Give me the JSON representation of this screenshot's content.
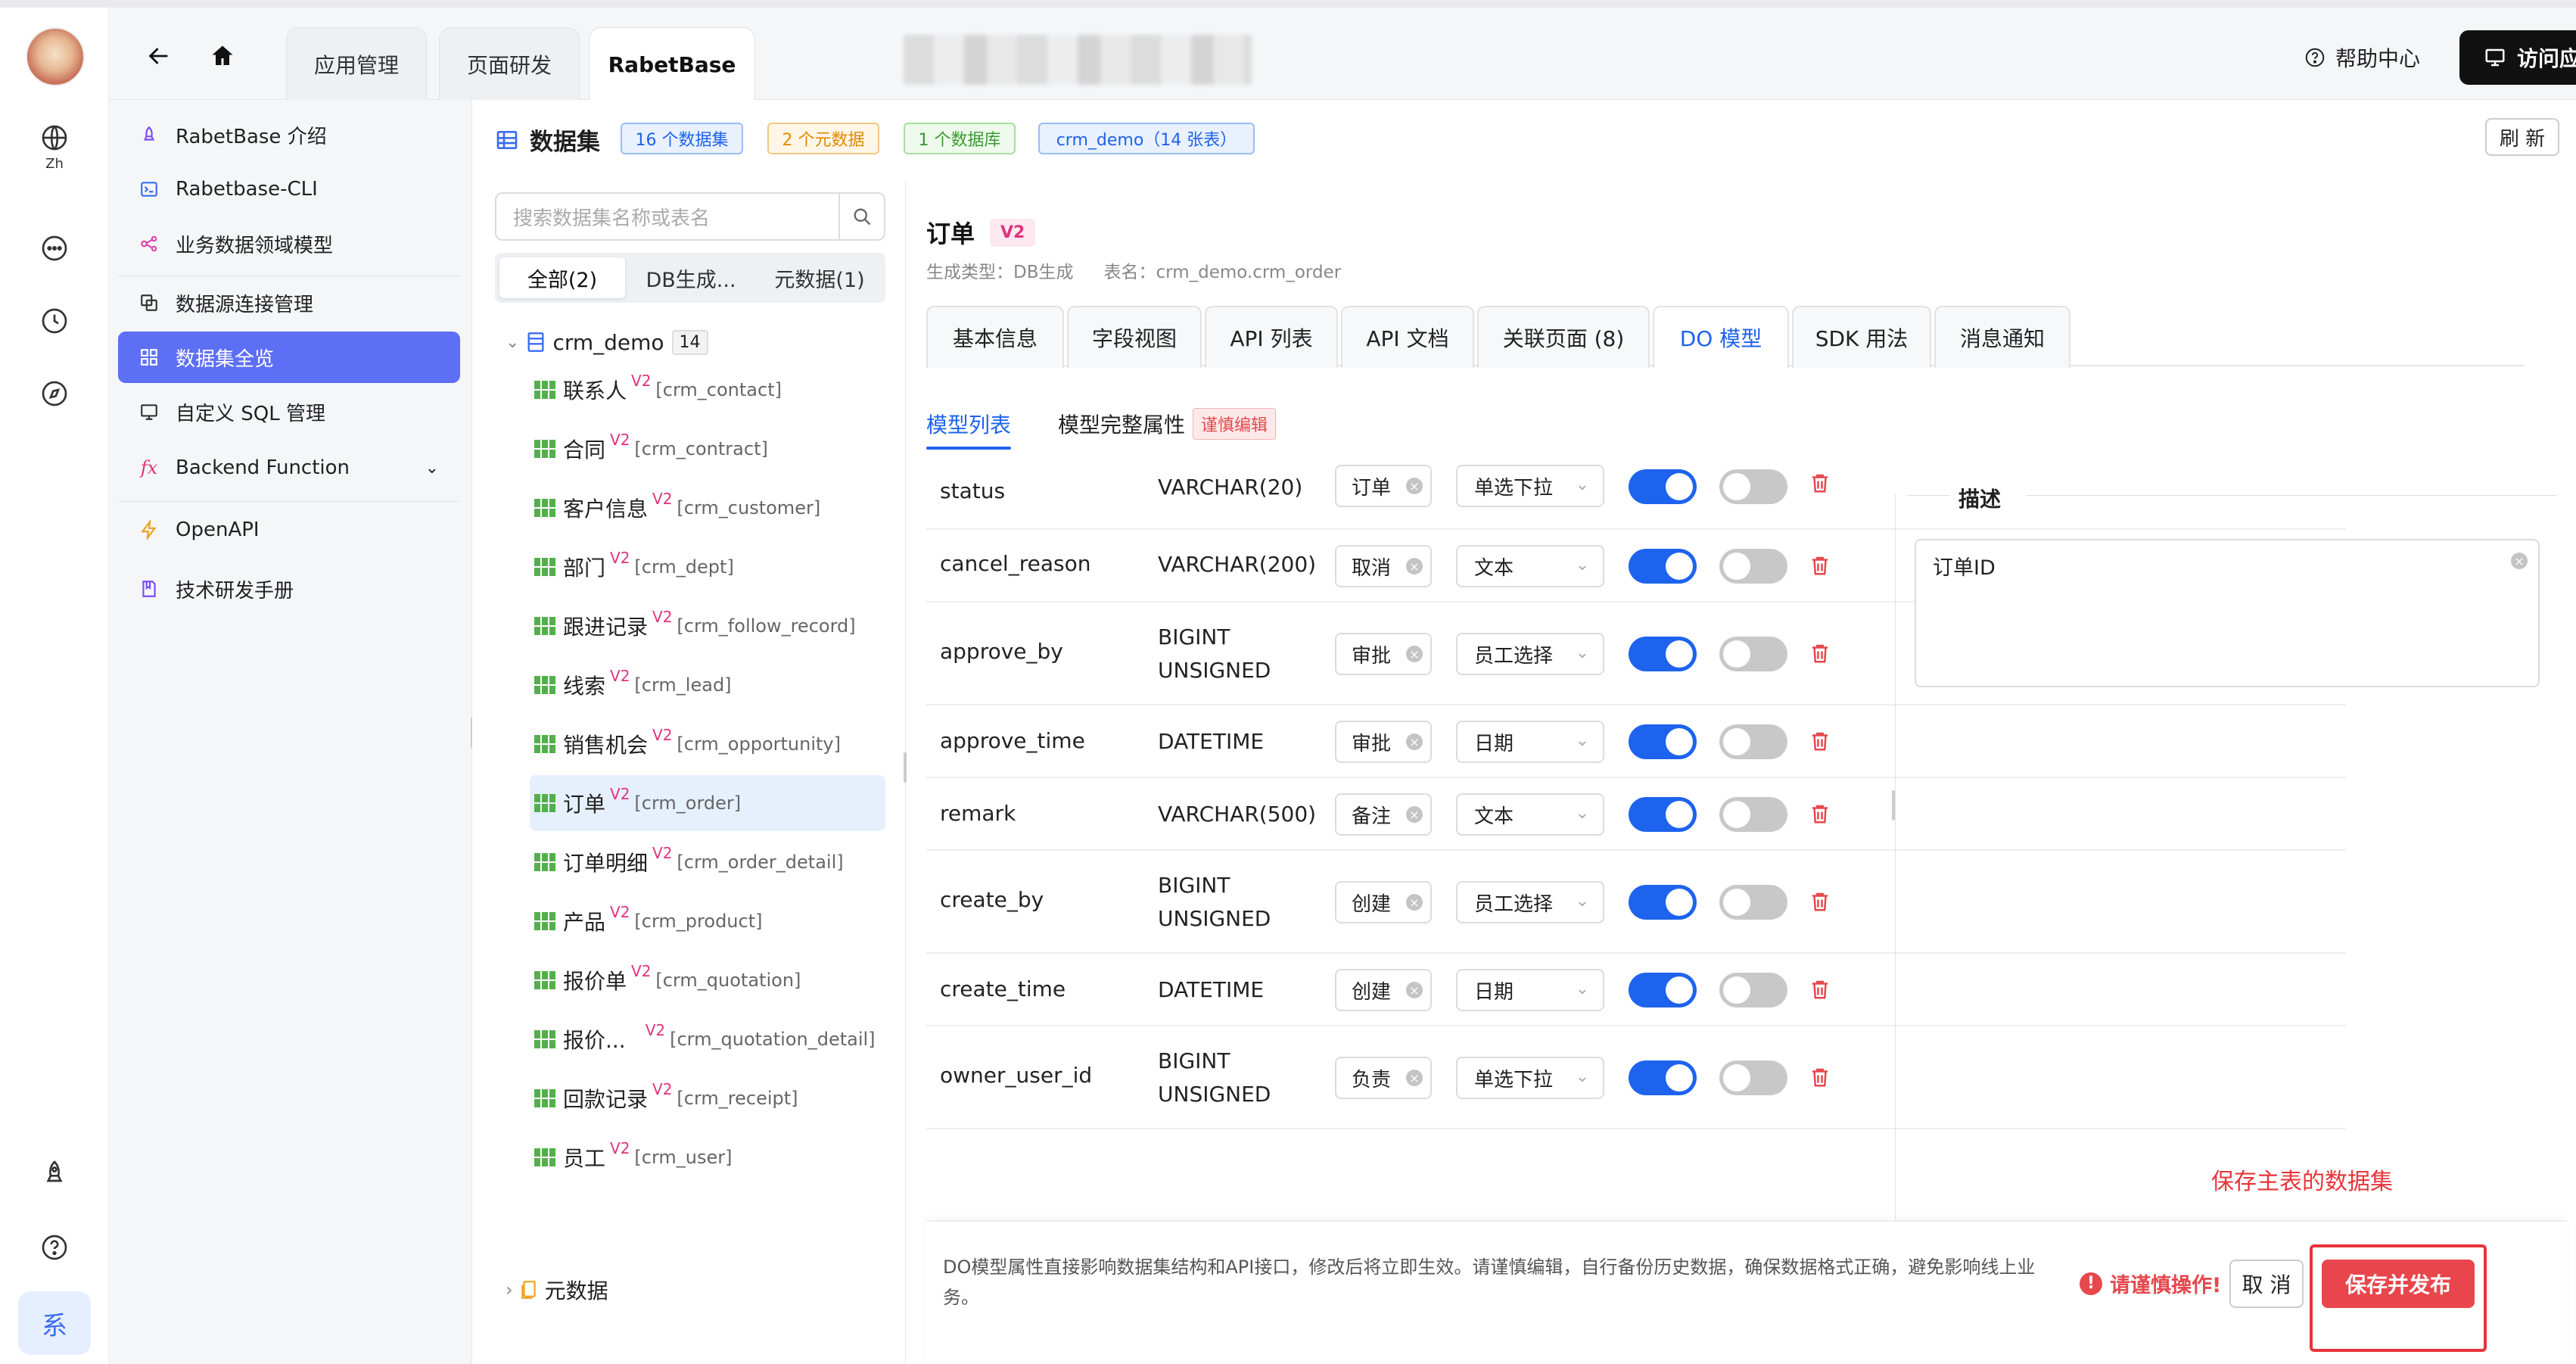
{
  "header": {
    "tabs": [
      {
        "label": "应用管理"
      },
      {
        "label": "页面研发"
      },
      {
        "label": "RabetBase"
      }
    ],
    "help_label": "帮助中心",
    "visit_label": "访问应用系统"
  },
  "rail": {
    "lang_label": "Zh",
    "system_label": "系"
  },
  "sidebar": {
    "items": [
      {
        "label": "RabetBase 介绍",
        "icon": "rocket-icon"
      },
      {
        "label": "Rabetbase-CLI",
        "icon": "terminal-icon"
      },
      {
        "label": "业务数据领域模型",
        "icon": "graph-icon"
      },
      {
        "label": "数据源连接管理",
        "icon": "link-icon"
      },
      {
        "label": "数据集全览",
        "icon": "grid-icon"
      },
      {
        "label": "自定义 SQL 管理",
        "icon": "sql-icon"
      },
      {
        "label": "Backend Function",
        "icon": "fx-icon"
      },
      {
        "label": "OpenAPI",
        "icon": "bolt-icon"
      },
      {
        "label": "技术研发手册",
        "icon": "book-icon"
      }
    ]
  },
  "dataset": {
    "title": "数据集",
    "badges": [
      "16 个数据集",
      "2 个元数据",
      "1 个数据库",
      "crm_demo（14 张表）"
    ],
    "refresh_label": "刷 新",
    "search_placeholder": "搜索数据集名称或表名",
    "filters": [
      "全部(2)",
      "DB生成...",
      "元数据(1)"
    ],
    "root": {
      "name": "crm_demo",
      "count": "14"
    },
    "version_tag": "V2",
    "tables": [
      {
        "name": "联系人",
        "table": "[crm_contact]"
      },
      {
        "name": "合同",
        "table": "[crm_contract]"
      },
      {
        "name": "客户信息",
        "table": "[crm_customer]"
      },
      {
        "name": "部门",
        "table": "[crm_dept]"
      },
      {
        "name": "跟进记录",
        "table": "[crm_follow_record]"
      },
      {
        "name": "线索",
        "table": "[crm_lead]"
      },
      {
        "name": "销售机会",
        "table": "[crm_opportunity]"
      },
      {
        "name": "订单",
        "table": "[crm_order]"
      },
      {
        "name": "订单明细",
        "table": "[crm_order_detail]"
      },
      {
        "name": "产品",
        "table": "[crm_product]"
      },
      {
        "name": "报价单",
        "table": "[crm_quotation]"
      },
      {
        "name": "报价...",
        "table": "[crm_quotation_detail]"
      },
      {
        "name": "回款记录",
        "table": "[crm_receipt]"
      },
      {
        "name": "员工",
        "table": "[crm_user]"
      }
    ],
    "meta_root": "元数据"
  },
  "detail": {
    "title": "订单",
    "version": "V2",
    "gen_type": "生成类型：DB生成",
    "table_name": "表名：crm_demo.crm_order",
    "tabs": [
      "基本信息",
      "字段视图",
      "API 列表",
      "API 文档",
      "关联页面 (8)",
      "DO 模型",
      "SDK 用法",
      "消息通知"
    ],
    "subtabs": {
      "list": "模型列表",
      "full": "模型完整属性",
      "warn": "谨慎编辑"
    },
    "fields": [
      {
        "name": "status",
        "type": "VARCHAR(20)",
        "desc": "订单",
        "widget": "单选下拉",
        "enabled": true,
        "required": false
      },
      {
        "name": "cancel_reason",
        "type": "VARCHAR(200)",
        "desc": "取消",
        "widget": "文本",
        "enabled": true,
        "required": false
      },
      {
        "name": "approve_by",
        "type": "BIGINT UNSIGNED",
        "desc": "审批",
        "widget": "员工选择",
        "enabled": true,
        "required": false
      },
      {
        "name": "approve_time",
        "type": "DATETIME",
        "desc": "审批",
        "widget": "日期",
        "enabled": true,
        "required": false
      },
      {
        "name": "remark",
        "type": "VARCHAR(500)",
        "desc": "备注",
        "widget": "文本",
        "enabled": true,
        "required": false
      },
      {
        "name": "create_by",
        "type": "BIGINT UNSIGNED",
        "desc": "创建",
        "widget": "员工选择",
        "enabled": true,
        "required": false
      },
      {
        "name": "create_time",
        "type": "DATETIME",
        "desc": "创建",
        "widget": "日期",
        "enabled": true,
        "required": false
      },
      {
        "name": "owner_user_id",
        "type": "BIGINT UNSIGNED",
        "desc": "负责",
        "widget": "单选下拉",
        "enabled": true,
        "required": false
      }
    ],
    "desc_panel": {
      "title": "描述",
      "value": "订单ID"
    },
    "annotation": "保存主表的数据集",
    "footer": {
      "note": "DO模型属性直接影响数据集结构和API接口，修改后将立即生效。请谨慎编辑，自行备份历史数据，确保数据格式正确，避免影响线上业务。",
      "warning": "请谨慎操作!",
      "cancel_label": "取 消",
      "publish_label": "保存并发布"
    }
  }
}
